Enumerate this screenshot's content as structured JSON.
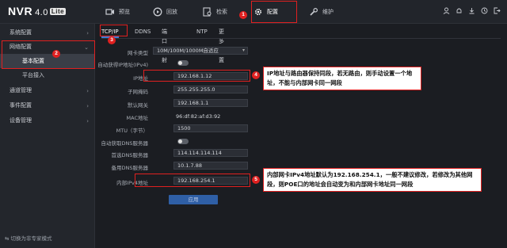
{
  "header": {
    "logo": "NVR",
    "version": "4.0",
    "edition": "Lite",
    "nav": [
      {
        "label": "预览",
        "icon": "camera-icon"
      },
      {
        "label": "回放",
        "icon": "playback-icon"
      },
      {
        "label": "检索",
        "icon": "search-icon"
      },
      {
        "label": "配置",
        "icon": "gear-icon"
      },
      {
        "label": "维护",
        "icon": "wrench-icon"
      }
    ],
    "right_icons": [
      "user-icon",
      "bell-icon",
      "download-icon",
      "clock-icon",
      "exit-icon"
    ]
  },
  "sidebar": {
    "items": [
      {
        "label": "系统配置"
      },
      {
        "label": "网络配置"
      },
      {
        "label": "基本配置"
      },
      {
        "label": "平台接入"
      },
      {
        "label": "通道管理"
      },
      {
        "label": "事件配置"
      },
      {
        "label": "设备管理"
      }
    ],
    "footer": "切换为非专家模式"
  },
  "tabs": [
    "TCP/IP",
    "DDNS",
    "端口映射",
    "NTP",
    "更多配置"
  ],
  "form": {
    "nic_type": {
      "label": "网卡类型",
      "value": "10M/100M/1000M自适应"
    },
    "dhcp_ipv4": {
      "label": "自动获得IP地址(IPv4)"
    },
    "ip": {
      "label": "IP地址",
      "value": "192.168.1.12"
    },
    "mask": {
      "label": "子网掩码",
      "value": "255.255.255.0"
    },
    "gateway": {
      "label": "默认网关",
      "value": "192.168.1.1"
    },
    "mac": {
      "label": "MAC地址",
      "value": "96:df:82:af:d3:92"
    },
    "mtu": {
      "label": "MTU（字节）",
      "value": "1500"
    },
    "dns_auto": {
      "label": "自动获取DNS服务器"
    },
    "dns1": {
      "label": "首选DNS服务器",
      "value": "114.114.114.114"
    },
    "dns2": {
      "label": "备用DNS服务器",
      "value": "10.1.7.88"
    },
    "internal_ipv4": {
      "label": "内部IPv4地址",
      "value": "192.168.254.1"
    },
    "apply": "应用"
  },
  "annotations": {
    "badges": [
      "1",
      "2",
      "3",
      "4",
      "5"
    ],
    "callout_ip": "IP地址与路由器保持同段，若无路由，则手动设置一个地址，不能与内部网卡同一网段",
    "callout_internal": "内部网卡IPv4地址默认为192.168.254.1，一般不建议修改，若修改为其他网段，则POE口的地址会自动变为和内部网卡地址同一网段"
  },
  "colors": {
    "accent": "#3a7bd5",
    "annotation": "#e02020",
    "background": "#1b1d22"
  }
}
